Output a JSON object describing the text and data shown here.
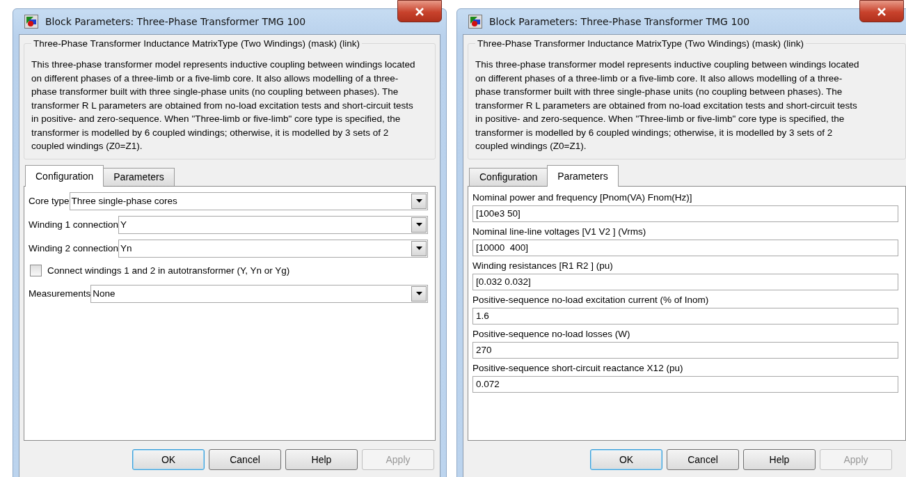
{
  "dialogs": [
    {
      "title": "Block Parameters: Three-Phase Transformer TMG 100",
      "group_title": "Three-Phase Transformer Inductance MatrixType (Two Windings) (mask) (link)",
      "description": "This three-phase transformer model represents inductive coupling between windings located on different phases of a three-limb or a five-limb core.  It also allows modelling of a three-phase transformer built with three single-phase units (no coupling between phases). The transformer R L parameters are obtained from no-load excitation tests and short-circuit tests in positive- and zero-sequence. When \"Three-limb or five-limb\" core type is specified, the transformer is modelled by 6 coupled windings; otherwise, it is modelled by 3 sets of 2 coupled windings (Z0=Z1).",
      "tabs": [
        {
          "label": "Configuration",
          "selected": true
        },
        {
          "label": "Parameters",
          "selected": false
        }
      ],
      "rows": [
        {
          "kind": "dropdown",
          "label": "Core type",
          "value": "Three single-phase cores"
        },
        {
          "kind": "dropdown",
          "label": "Winding 1 connection",
          "value": "Y"
        },
        {
          "kind": "dropdown",
          "label": "Winding 2 connection",
          "value": "Yn"
        },
        {
          "kind": "checkbox",
          "label": "Connect windings 1 and 2  in autotransformer  (Y, Yn or Yg)",
          "checked": false
        },
        {
          "kind": "dropdown",
          "label": "Measurements",
          "value": "None"
        }
      ],
      "buttons": [
        {
          "label": "OK",
          "focused": true,
          "disabled": false
        },
        {
          "label": "Cancel",
          "focused": false,
          "disabled": false
        },
        {
          "label": "Help",
          "focused": false,
          "disabled": false
        },
        {
          "label": "Apply",
          "focused": false,
          "disabled": true
        }
      ]
    },
    {
      "title": "Block Parameters: Three-Phase Transformer TMG 100",
      "group_title": "Three-Phase Transformer Inductance MatrixType (Two Windings) (mask) (link)",
      "description": "This three-phase transformer model represents inductive coupling between windings located on different phases of a three-limb or a five-limb core.  It also allows modelling of a three-phase transformer built with three single-phase units (no coupling between phases). The transformer R L parameters are obtained from no-load excitation tests and short-circuit tests in positive- and zero-sequence. When \"Three-limb or five-limb\" core type is specified, the transformer is modelled by 6 coupled windings; otherwise, it is modelled by 3 sets of 2 coupled windings (Z0=Z1).",
      "tabs": [
        {
          "label": "Configuration",
          "selected": false
        },
        {
          "label": "Parameters",
          "selected": true
        }
      ],
      "rows": [
        {
          "kind": "field",
          "label": "Nominal power and frequency [Pnom(VA) Fnom(Hz)]",
          "value": "[100e3 50]"
        },
        {
          "kind": "field",
          "label": "Nominal line-line voltages [V1 V2 ] (Vrms)",
          "value": "[10000  400]"
        },
        {
          "kind": "field",
          "label": "Winding resistances [R1 R2 ] (pu)",
          "value": "[0.032 0.032]"
        },
        {
          "kind": "field",
          "label": "Positive-sequence no-load  excitation current (% of Inom)",
          "value": "1.6"
        },
        {
          "kind": "field",
          "label": "Positive-sequence no-load losses (W)",
          "value": "270"
        },
        {
          "kind": "field",
          "label": "Positive-sequence short-circuit reactance  X12 (pu)",
          "value": "0.072"
        }
      ],
      "buttons": [
        {
          "label": "OK",
          "focused": true,
          "disabled": false
        },
        {
          "label": "Cancel",
          "focused": false,
          "disabled": false
        },
        {
          "label": "Help",
          "focused": false,
          "disabled": false
        },
        {
          "label": "Apply",
          "focused": false,
          "disabled": true
        }
      ]
    }
  ]
}
